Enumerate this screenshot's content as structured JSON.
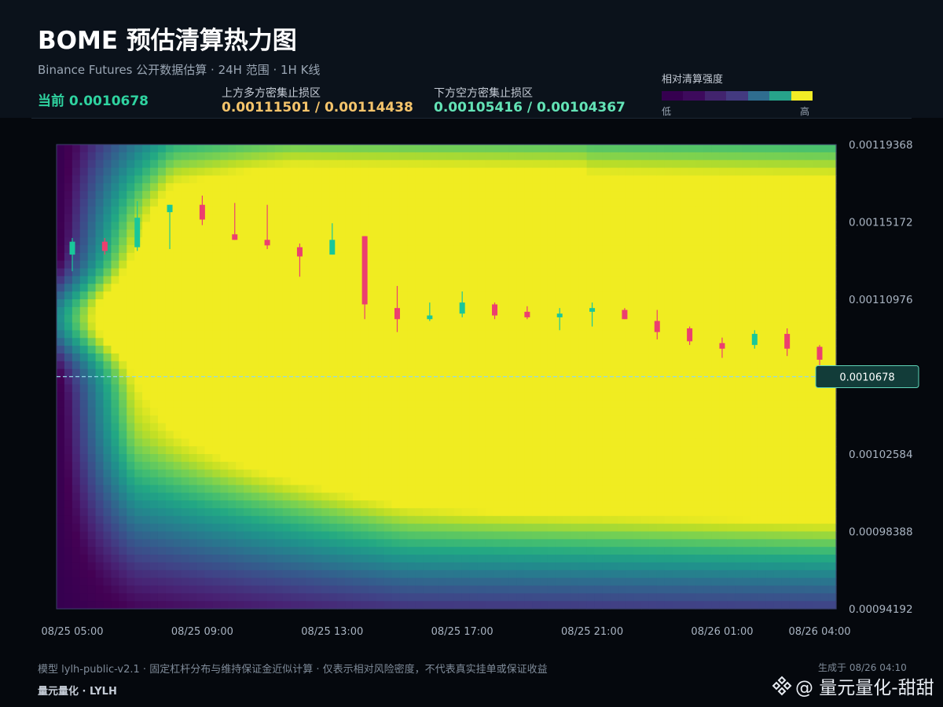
{
  "header": {
    "title": "BOME 预估清算热力图",
    "subtitle": "Binance Futures 公开数据估算 · 24H 范围 · 1H K线",
    "current_label": "当前 0.0010678",
    "upper_zone_label": "上方多方密集止损区",
    "upper_zone_values": "0.00111501 / 0.00114438",
    "lower_zone_label": "下方空方密集止损区",
    "lower_zone_values": "0.00105416 / 0.00104367",
    "legend_title": "相对清算强度",
    "legend_low": "低",
    "legend_high": "高"
  },
  "colors": {
    "up_candle": "#19c79a",
    "down_candle": "#ec3f6f",
    "upper_zone": "#f5c46b",
    "lower_zone": "#63e3b6",
    "legend_stops": [
      "#35004f",
      "#3d0a5c",
      "#42246e",
      "#433a80",
      "#2f6d8f",
      "#27a38a",
      "#f2ec26"
    ]
  },
  "chart_data": {
    "type": "heatmap",
    "overlay": "candlestick",
    "x_tick_labels": [
      "08/25 05:00",
      "08/25 09:00",
      "08/25 13:00",
      "08/25 17:00",
      "08/25 21:00",
      "08/26 01:00",
      "08/26 04:00"
    ],
    "y_tick_labels": [
      "0.00119368",
      "0.00115172",
      "0.00110976",
      "0.00102584",
      "0.00098388",
      "0.00094192"
    ],
    "ylim": [
      0.00094192,
      0.00119368
    ],
    "current_price": 0.0010678,
    "current_price_label": "0.0010678",
    "candles": [
      {
        "t": "08/25 05:00",
        "o": 0.001134,
        "h": 0.001143,
        "l": 0.001125,
        "c": 0.001141
      },
      {
        "t": "08/25 06:00",
        "o": 0.001141,
        "h": 0.001143,
        "l": 0.001134,
        "c": 0.001136
      },
      {
        "t": "08/25 07:00",
        "o": 0.001138,
        "h": 0.001163,
        "l": 0.001136,
        "c": 0.001154
      },
      {
        "t": "08/25 08:00",
        "o": 0.001157,
        "h": 0.001161,
        "l": 0.001137,
        "c": 0.001161
      },
      {
        "t": "08/25 09:00",
        "o": 0.001161,
        "h": 0.001166,
        "l": 0.00115,
        "c": 0.001153
      },
      {
        "t": "08/25 10:00",
        "o": 0.001145,
        "h": 0.001162,
        "l": 0.001142,
        "c": 0.001142
      },
      {
        "t": "08/25 11:00",
        "o": 0.001142,
        "h": 0.001161,
        "l": 0.001137,
        "c": 0.001139
      },
      {
        "t": "08/25 12:00",
        "o": 0.001138,
        "h": 0.00114,
        "l": 0.001122,
        "c": 0.001133
      },
      {
        "t": "08/25 13:00",
        "o": 0.001134,
        "h": 0.001151,
        "l": 0.001134,
        "c": 0.001142
      },
      {
        "t": "08/25 14:00",
        "o": 0.001144,
        "h": 0.001144,
        "l": 0.001099,
        "c": 0.001107
      },
      {
        "t": "08/25 15:00",
        "o": 0.001105,
        "h": 0.001117,
        "l": 0.001092,
        "c": 0.001099
      },
      {
        "t": "08/25 16:00",
        "o": 0.001099,
        "h": 0.001108,
        "l": 0.001098,
        "c": 0.001101
      },
      {
        "t": "08/25 17:00",
        "o": 0.001102,
        "h": 0.001114,
        "l": 0.0011,
        "c": 0.001108
      },
      {
        "t": "08/25 18:00",
        "o": 0.001107,
        "h": 0.001108,
        "l": 0.001099,
        "c": 0.001101
      },
      {
        "t": "08/25 19:00",
        "o": 0.001103,
        "h": 0.001106,
        "l": 0.001099,
        "c": 0.0011
      },
      {
        "t": "08/25 20:00",
        "o": 0.0011,
        "h": 0.001105,
        "l": 0.001093,
        "c": 0.001102
      },
      {
        "t": "08/25 21:00",
        "o": 0.001103,
        "h": 0.001108,
        "l": 0.001095,
        "c": 0.001105
      },
      {
        "t": "08/25 22:00",
        "o": 0.001104,
        "h": 0.001105,
        "l": 0.001099,
        "c": 0.001099
      },
      {
        "t": "08/25 23:00",
        "o": 0.001098,
        "h": 0.001104,
        "l": 0.001088,
        "c": 0.001092
      },
      {
        "t": "08/26 00:00",
        "o": 0.001094,
        "h": 0.001095,
        "l": 0.001085,
        "c": 0.001087
      },
      {
        "t": "08/26 01:00",
        "o": 0.001086,
        "h": 0.001089,
        "l": 0.001078,
        "c": 0.001083
      },
      {
        "t": "08/26 02:00",
        "o": 0.001085,
        "h": 0.001093,
        "l": 0.001083,
        "c": 0.001091
      },
      {
        "t": "08/26 03:00",
        "o": 0.001091,
        "h": 0.001094,
        "l": 0.001079,
        "c": 0.001083
      },
      {
        "t": "08/26 04:00",
        "o": 0.001084,
        "h": 0.001085,
        "l": 0.001071,
        "c": 0.001077
      }
    ],
    "heat_bands": [
      {
        "start": 0.001175,
        "end": 0.001165,
        "y0": 0.00115,
        "y1": 0.001145,
        "width": 0.0001,
        "intensity": 0.45,
        "fade_in": 0.15
      },
      {
        "start": 0.00115,
        "end": 0.00115,
        "y0": 0.00112,
        "y1": 0.00111,
        "width": 8e-05,
        "intensity": 0.5,
        "fade_in": 0.15
      },
      {
        "start": 0.001165,
        "end": 0.001155,
        "y0": 0.001132,
        "y1": 0.001128,
        "width": 0.0001,
        "intensity": 0.38,
        "fade_in": 0.3
      },
      {
        "start": 0.001102,
        "end": 0.001107,
        "y0": 0.001096,
        "y1": 0.001096,
        "width": 7e-05,
        "intensity": 0.55,
        "fade_in": 0.25,
        "stop": 0.68
      },
      {
        "start": 0.001107,
        "end": 0.0011,
        "y0": 0.001092,
        "y1": 0.001092,
        "width": 3e-05,
        "intensity": 0.5,
        "fade_in": 0.0,
        "peak_at": 0.37,
        "peak_boost": 0.5,
        "peak_width": 0.12,
        "stop": 0.45
      },
      {
        "start": 0.001052,
        "end": 0.001045,
        "y0": 0.00104,
        "y1": 0.001038,
        "width": 0.0001,
        "intensity": 0.62,
        "fade_in": 0.1,
        "grow": 0.4
      },
      {
        "start": 0.001045,
        "end": 0.001041,
        "y0": 0.001038,
        "y1": 0.001038,
        "width": 5e-05,
        "intensity": 0.5,
        "fade_in": 0.55,
        "grow": 0.5
      },
      {
        "start": 0.000997,
        "end": 0.000993,
        "y0": 0.000993,
        "y1": 0.000992,
        "width": 7e-05,
        "intensity": 0.4,
        "fade_in": 0.45
      }
    ]
  },
  "footer": {
    "note": "模型 lylh-public-v2.1 · 固定杠杆分布与维持保证金近似计算 · 仅表示相对风险密度，不代表真实挂单或保证收益",
    "brand": "量元量化 · LYLH",
    "generated": "生成于 08/26 04:10",
    "watermark": "@ 量元量化-甜甜"
  }
}
